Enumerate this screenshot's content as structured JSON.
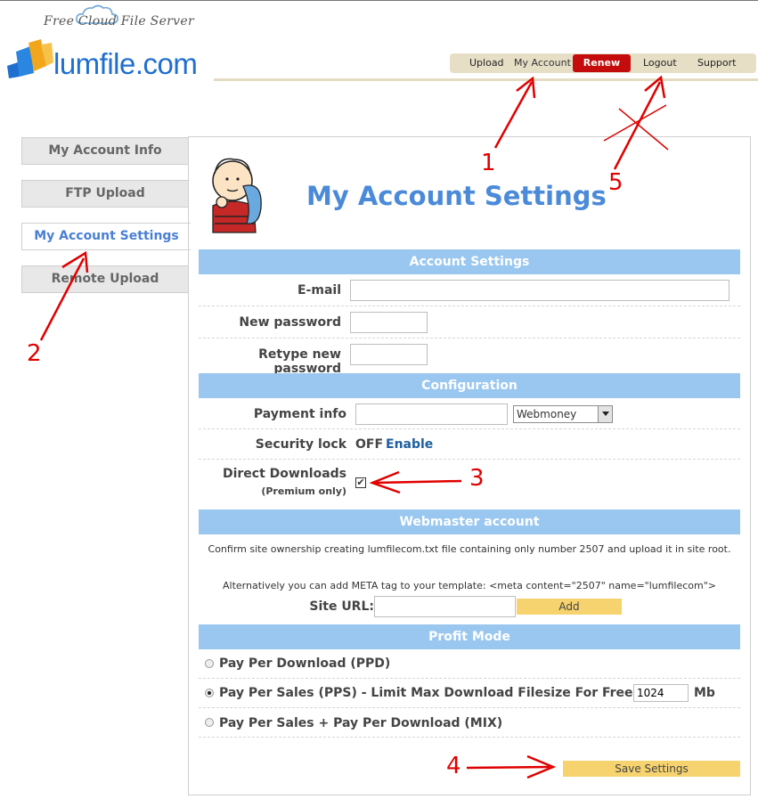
{
  "header": {
    "tagline": "Free Cloud File Server",
    "logo_text": "lumfile.com",
    "brand_color": "#1f6fd0"
  },
  "topnav": {
    "upload": "Upload",
    "my_account": "My Account",
    "renew": "Renew",
    "logout": "Logout",
    "support": "Support",
    "renew_color": "#c40c0c"
  },
  "sidebar": {
    "items": [
      {
        "label": "My Account Info"
      },
      {
        "label": "FTP Upload"
      },
      {
        "label": "My Account Settings"
      },
      {
        "label": "Remote Upload"
      }
    ]
  },
  "main": {
    "title": "My Account Settings",
    "sections": {
      "account": "Account Settings",
      "configuration": "Configuration",
      "webmaster": "Webmaster account",
      "profit": "Profit Mode"
    },
    "account": {
      "email_label": "E-mail",
      "new_password_label": "New password",
      "retype_password_label": "Retype new password"
    },
    "config": {
      "payment_label": "Payment info",
      "payment_option": "Webmoney",
      "security_label": "Security lock",
      "security_state": "OFF",
      "security_action": "Enable",
      "direct_label": "Direct Downloads",
      "direct_sub": "(Premium only)",
      "direct_checked": true
    },
    "webmaster": {
      "line1": "Confirm site ownership creating lumfilecom.txt file containing only number 2507 and upload it in site root.",
      "line2": "Alternatively you can add META tag to your template: <meta content=\"2507\" name=\"lumfilecom\">",
      "site_url_label": "Site URL:",
      "add_label": "Add"
    },
    "profit": {
      "ppd": "Pay Per Download (PPD)",
      "pps": "Pay Per Sales (PPS) - Limit Max Download Filesize For Free User:",
      "pps_limit": "1024",
      "pps_unit": "Mb",
      "mix": "Pay Per Sales + Pay Per Download (MIX)",
      "selected": "pps"
    },
    "save_label": "Save Settings"
  },
  "annotations": {
    "n1": "1",
    "n2": "2",
    "n3": "3",
    "n4": "4",
    "n5": "5",
    "color": "#e00000"
  },
  "colors": {
    "section_bar": "#99c7f0",
    "button": "#f6d36f",
    "link": "#1f5fa0"
  }
}
